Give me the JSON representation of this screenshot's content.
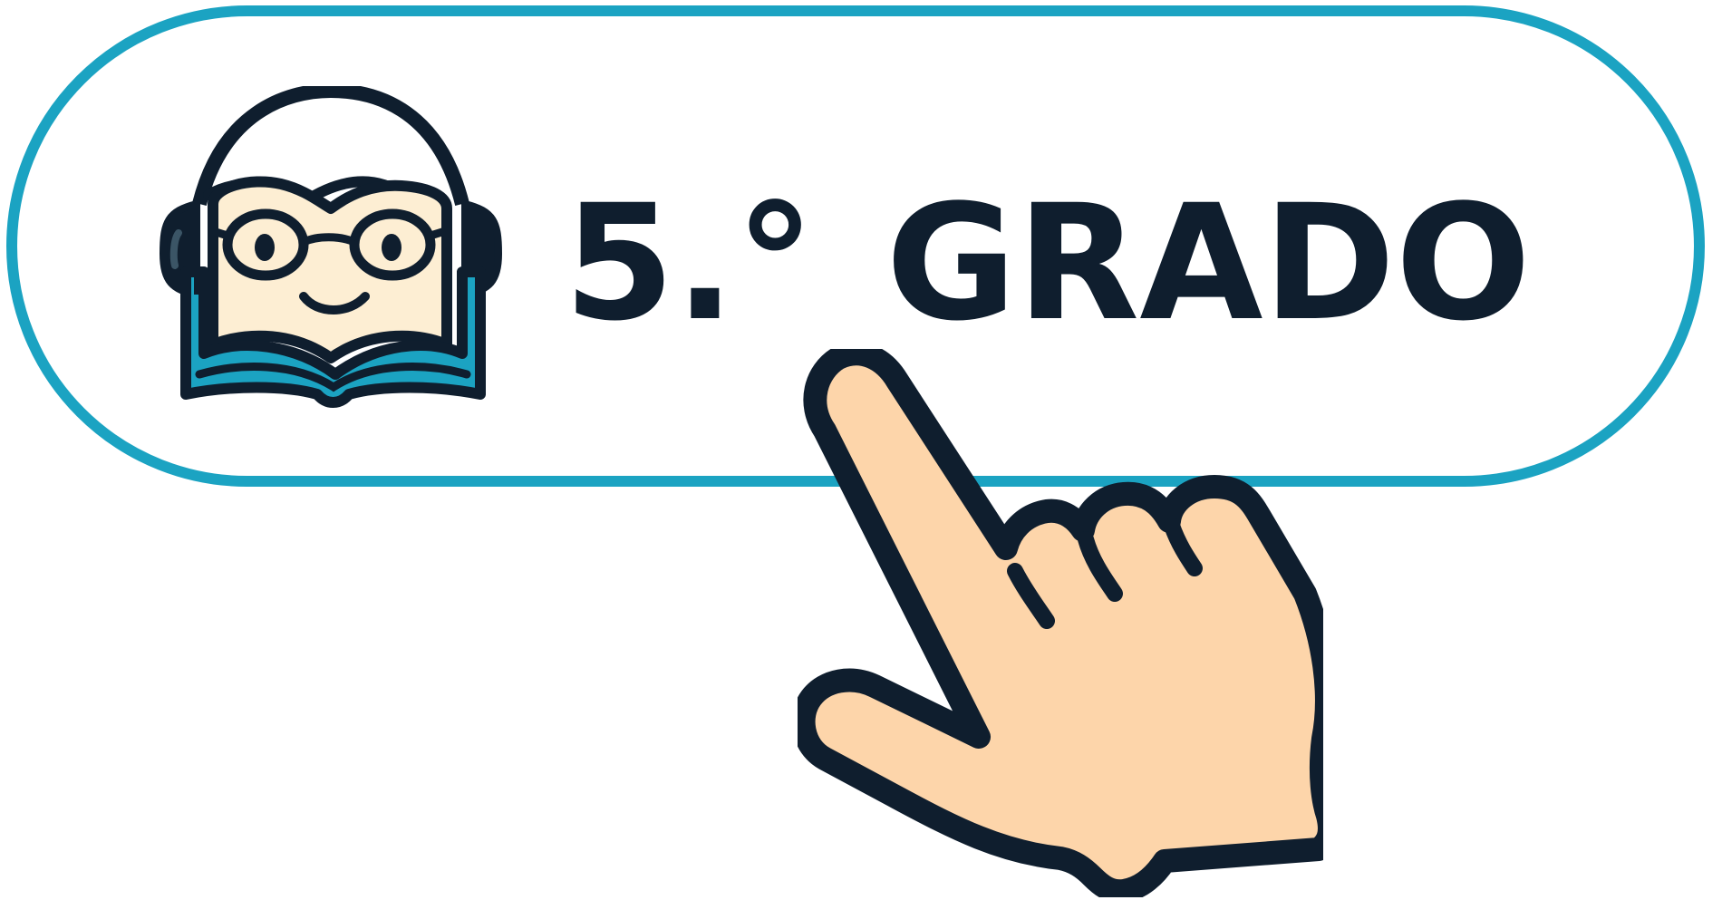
{
  "colors": {
    "accent": "#1ba3c2",
    "ink": "#0f1e2e",
    "skin": "#fdd5aa",
    "face": "#fdeed3",
    "book": "#1ba3c2"
  },
  "icons": {
    "mascot": "reading-student-with-headphones-icon",
    "pointer": "pointing-hand-icon"
  },
  "button": {
    "grade_number": "5.°",
    "grade_word": "GRADO"
  }
}
